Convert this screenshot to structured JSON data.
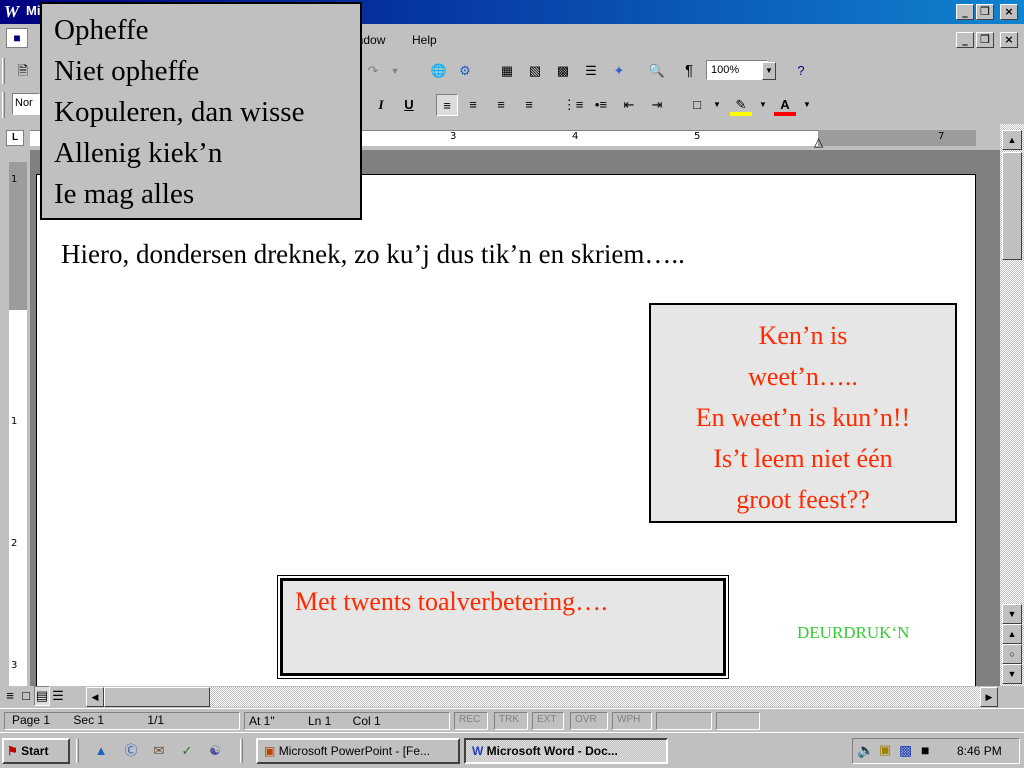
{
  "window": {
    "title": "Mi",
    "minimize": "_",
    "restore": "❒",
    "close": "×"
  },
  "menubar": {
    "items": [
      "indow",
      "Help"
    ]
  },
  "toolbar_std": {
    "zoom": "100%",
    "pilcrow": "¶"
  },
  "toolbar_fmt": {
    "style": "Nor",
    "italic": "I",
    "underline": "U"
  },
  "ruler": {
    "numbers": [
      "3",
      "4",
      "5",
      "7"
    ],
    "vnumbers": [
      "1",
      "1",
      "2",
      "3"
    ]
  },
  "document": {
    "heading": "Hiero, dondersen dreknek, zo ku’j dus tik’n en skriem…..",
    "callout_lines": [
      "Ken’n is",
      "weet’n…..",
      "En weet’n is kun’n!!",
      "Is’t leem niet één",
      "groot feest??"
    ],
    "box_text": "Met twents toalverbetering….",
    "label": "DEURDRUK‘N",
    "colors": {
      "callout_text": "#ff2a00",
      "label": "#33cc33"
    }
  },
  "popup": {
    "items": [
      "Opheffe",
      "Niet opheffe",
      "Kopuleren, dan wisse",
      "Allenig kiek’n",
      "Ie mag alles"
    ]
  },
  "statusbar": {
    "page": "Page  1",
    "sec": "Sec  1",
    "pages": "1/1",
    "at": "At  1\"",
    "ln": "Ln  1",
    "col": "Col  1",
    "modes": [
      "REC",
      "TRK",
      "EXT",
      "OVR",
      "WPH"
    ]
  },
  "taskbar": {
    "start": "Start",
    "tasks": [
      "Microsoft PowerPoint - [Fe...",
      "Microsoft Word - Doc..."
    ],
    "clock": "8:46 PM"
  }
}
